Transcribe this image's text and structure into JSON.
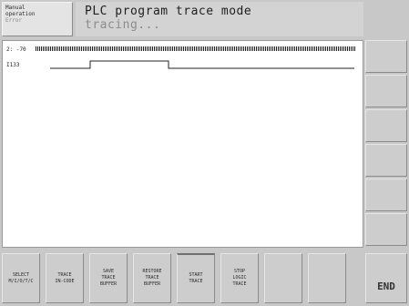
{
  "mode": {
    "line1": "Manual",
    "line2": "operation",
    "line3": "Error"
  },
  "header": {
    "title": "PLC program trace mode",
    "status": "tracing..."
  },
  "trace": {
    "range_label": "2:  -70",
    "signal_name": "I133"
  },
  "softkeys": [
    "SELECT\nM/I/O/T/C",
    "TRACE\nIN-CODE",
    "SAVE\nTRACE\nBUFFER",
    "RESTORE\nTRACE\nBUFFER",
    "START\nTRACE",
    "STOP\nLOGIC\nTRACE",
    "",
    ""
  ],
  "end_label": "END"
}
